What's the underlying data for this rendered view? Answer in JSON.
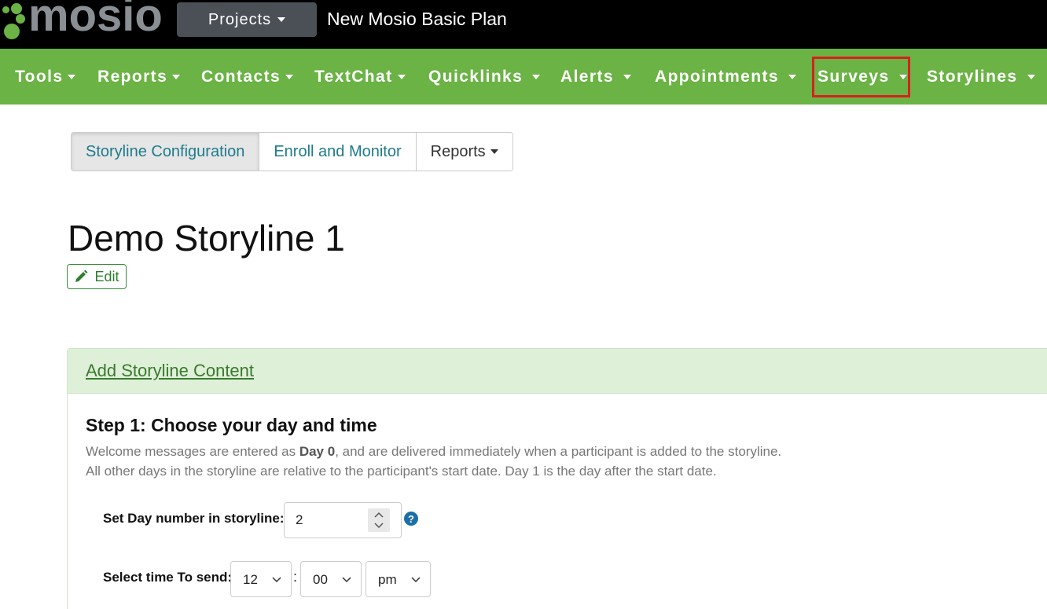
{
  "header": {
    "logo_text": "mosio",
    "projects_label": "Projects",
    "plan_title": "New Mosio Basic Plan"
  },
  "nav": {
    "items": [
      {
        "label": "Tools"
      },
      {
        "label": "Reports"
      },
      {
        "label": "Contacts"
      },
      {
        "label": "TextChat"
      },
      {
        "label": "Quicklinks"
      },
      {
        "label": "Alerts"
      },
      {
        "label": "Appointments"
      },
      {
        "label": "Surveys"
      },
      {
        "label": "Storylines"
      }
    ],
    "highlighted": "Surveys"
  },
  "tabs": [
    {
      "label": "Storyline Configuration",
      "active": true
    },
    {
      "label": "Enroll and Monitor",
      "active": false
    },
    {
      "label": "Reports",
      "active": false
    }
  ],
  "page": {
    "title": "Demo Storyline 1",
    "edit_label": "Edit"
  },
  "panel": {
    "heading": "Add Storyline Content",
    "step_title": "Step 1: Choose your day and time",
    "desc_line1_pre": "Welcome messages are entered as ",
    "desc_line1_bold": "Day 0",
    "desc_line1_post": ", and are delivered immediately when a participant is added to the storyline.",
    "desc_line2": "All other days in the storyline are relative to the participant's start date. Day 1 is the day after the start date.",
    "day_label": "Set Day number in storyline:",
    "day_value": "2",
    "help_symbol": "?",
    "time_label": "Select time To send:",
    "hour_value": "12",
    "time_separator": ":",
    "minute_value": "00",
    "ampm_value": "pm"
  },
  "colors": {
    "nav_green": "#6ab344",
    "highlight_red": "#d9201f",
    "panel_head": "#dff0d8",
    "link_teal": "#1e7b8c"
  }
}
